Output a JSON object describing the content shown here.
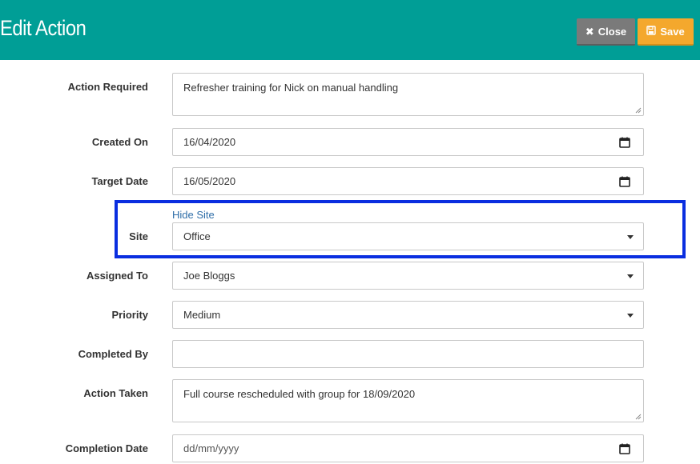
{
  "header": {
    "title": "Edit Action",
    "close_label": "Close",
    "save_label": "Save",
    "bg_color": "#009e96"
  },
  "form": {
    "action_required": {
      "label": "Action Required",
      "value": "Refresher training for Nick on manual handling"
    },
    "created_on": {
      "label": "Created On",
      "value": "16/04/2020"
    },
    "target_date": {
      "label": "Target Date",
      "value": "16/05/2020"
    },
    "site": {
      "label": "Site",
      "link": "Hide Site",
      "value": "Office"
    },
    "assigned_to": {
      "label": "Assigned To",
      "value": "Joe Bloggs"
    },
    "priority": {
      "label": "Priority",
      "value": "Medium"
    },
    "completed_by": {
      "label": "Completed By",
      "value": ""
    },
    "action_taken": {
      "label": "Action Taken",
      "value": "Full course rescheduled with group for 18/09/2020"
    },
    "completion_date": {
      "label": "Completion Date",
      "placeholder": "dd/mm/yyyy"
    }
  },
  "highlight_color": "#0a2ee0"
}
